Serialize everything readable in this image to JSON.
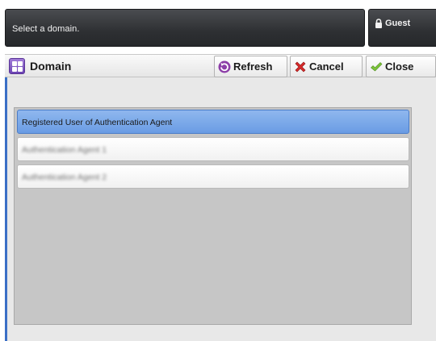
{
  "header": {
    "message": "Select a domain.",
    "user_label": "Guest",
    "user_icon": "lock-icon"
  },
  "toolbar": {
    "title": "Domain",
    "title_icon": "domain-icon",
    "buttons": [
      {
        "label": "Refresh",
        "icon": "refresh-icon"
      },
      {
        "label": "Cancel",
        "icon": "cancel-icon"
      },
      {
        "label": "Close",
        "icon": "checkmark-icon"
      }
    ]
  },
  "domain_list": {
    "items": [
      {
        "label": "Registered User of Authentication Agent",
        "selected": true
      },
      {
        "label": "Authentication Agent 1",
        "selected": false,
        "obscured": true
      },
      {
        "label": "Authentication Agent 2",
        "selected": false,
        "obscured": true
      }
    ]
  },
  "colors": {
    "header_bg": "#2e3033",
    "selection": "#6a9ce4",
    "list_bg": "#c6c6c6",
    "accent_edge": "#3a6fc6"
  }
}
